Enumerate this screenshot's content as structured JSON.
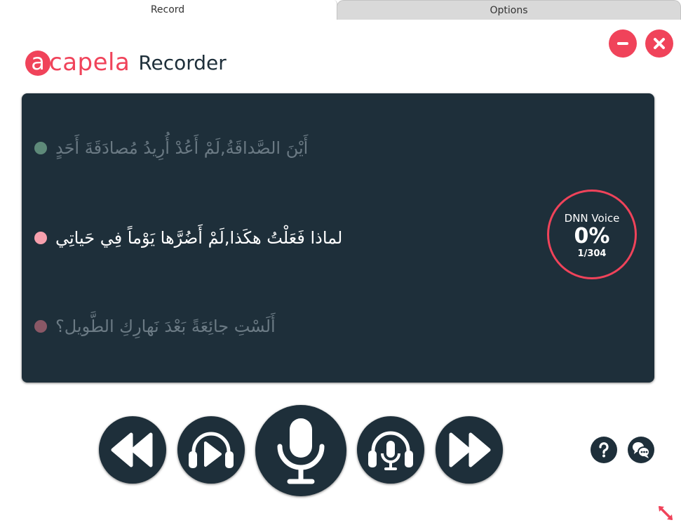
{
  "tabs": {
    "record": "Record",
    "options": "Options"
  },
  "header": {
    "logo_letter": "a",
    "logo_brand": "capela",
    "product": "Recorder"
  },
  "sentences": [
    {
      "text": "أَيْنَ الصَّداقَةُ,لَمْ أَعُدْ أُرِيدُ مُصادَقَةَ أَحَدٍ",
      "state": "done"
    },
    {
      "text": "لماذا فَعَلْتُ هكَذا,لَمْ أَضُرَّها يَوْماً فِي حَياتِي",
      "state": "current"
    },
    {
      "text": "أَلَسْتِ جائِعَةً بَعْدَ نَهارِكِ الطَّويل؟",
      "state": "pending"
    }
  ],
  "progress": {
    "label": "DNN Voice",
    "percent": "0%",
    "count": "1/304",
    "fraction": 0.0
  },
  "controls": {
    "rewind": "rewind-icon",
    "play": "play-headphones-icon",
    "record": "microphone-icon",
    "monitor": "mic-headphones-icon",
    "forward": "fast-forward-icon",
    "help": "help-icon",
    "language": "language-icon"
  },
  "colors": {
    "accent": "#f0435a",
    "panel": "#1e2f3a",
    "done_dot": "#6ea18a",
    "current_dot": "#f6a0ad",
    "pending_dot": "#8a5866"
  }
}
